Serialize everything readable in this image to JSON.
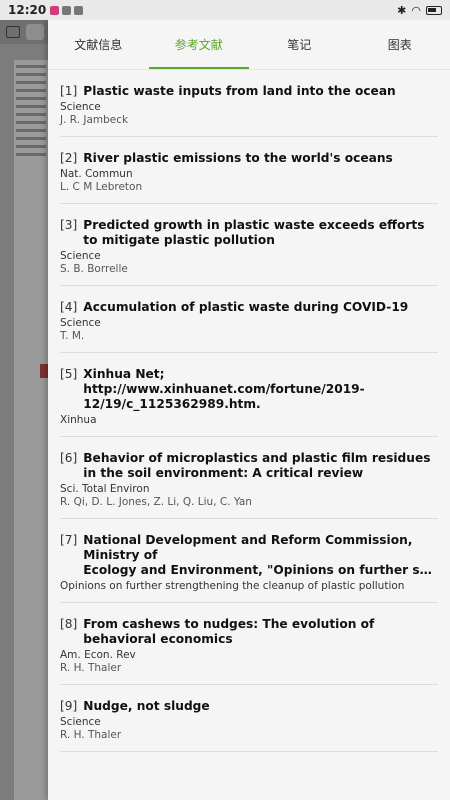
{
  "status_bar": {
    "time": "12:20"
  },
  "tabs": [
    {
      "label": "文献信息"
    },
    {
      "label": "参考文献"
    },
    {
      "label": "笔记"
    },
    {
      "label": "图表"
    }
  ],
  "references": [
    {
      "num": "[1]",
      "title": "Plastic waste inputs from land into the ocean",
      "journal": "Science",
      "authors": "J. R. Jambeck"
    },
    {
      "num": "[2]",
      "title": "River plastic emissions to the world's oceans",
      "journal": "Nat. Commun",
      "authors": "L. C M Lebreton"
    },
    {
      "num": "[3]",
      "title": "Predicted growth in plastic waste exceeds efforts to mitigate plastic pollution",
      "journal": "Science",
      "authors": "S. B. Borrelle"
    },
    {
      "num": "[4]",
      "title": "Accumulation of plastic waste during COVID-19",
      "journal": "Science",
      "authors": "T. M."
    },
    {
      "num": "[5]",
      "title": "Xinhua Net; http://www.xinhuanet.com/fortune/2019-12/19/c_1125362989.htm.",
      "journal": "Xinhua",
      "authors": ""
    },
    {
      "num": "[6]",
      "title": "Behavior of microplastics and plastic film residues in the soil environment: A critical review",
      "journal": "Sci. Total Environ",
      "authors": "R. Qi, D. L. Jones, Z. Li, Q. Liu, C. Yan"
    },
    {
      "num": "[7]",
      "title_line1": "National Development and Reform Commission, Ministry of",
      "title_line2": "Ecology and Environment, \"Opinions on further strengtheni…",
      "journal": "Opinions on further strengthening the cleanup of plastic pollution",
      "authors": ""
    },
    {
      "num": "[8]",
      "title": "From cashews to nudges: The evolution of behavioral economics",
      "journal": "Am. Econ. Rev",
      "authors": "R. H. Thaler"
    },
    {
      "num": "[9]",
      "title": "Nudge, not sludge",
      "journal": "Science",
      "authors": "R. H. Thaler"
    }
  ]
}
